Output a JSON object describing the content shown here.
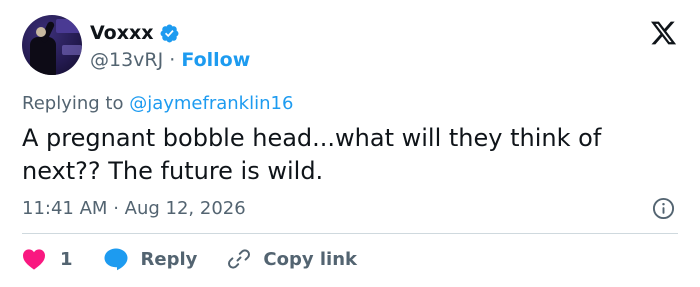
{
  "author": {
    "name": "Voxxx",
    "handle": "@13vRJ",
    "separator": "·",
    "follow_label": "Follow",
    "verified": true
  },
  "reply_context": {
    "prefix": "Replying to ",
    "mention": "@jaymefranklin16"
  },
  "tweet": {
    "text": "A pregnant bobble head...what will they think of next?? The future is wild.",
    "time": "11:41 AM",
    "date_separator": "·",
    "date": "Aug 12, 2026"
  },
  "actions": {
    "like_count": "1",
    "reply_label": "Reply",
    "copy_link_label": "Copy link"
  },
  "colors": {
    "accent": "#1d9bf0",
    "like": "#f91880",
    "text": "#0f1419",
    "muted": "#536471",
    "divider": "#cfd9de"
  },
  "icons": [
    "verified-badge-icon",
    "x-logo-icon",
    "info-icon",
    "heart-icon",
    "reply-bubble-icon",
    "link-icon"
  ]
}
